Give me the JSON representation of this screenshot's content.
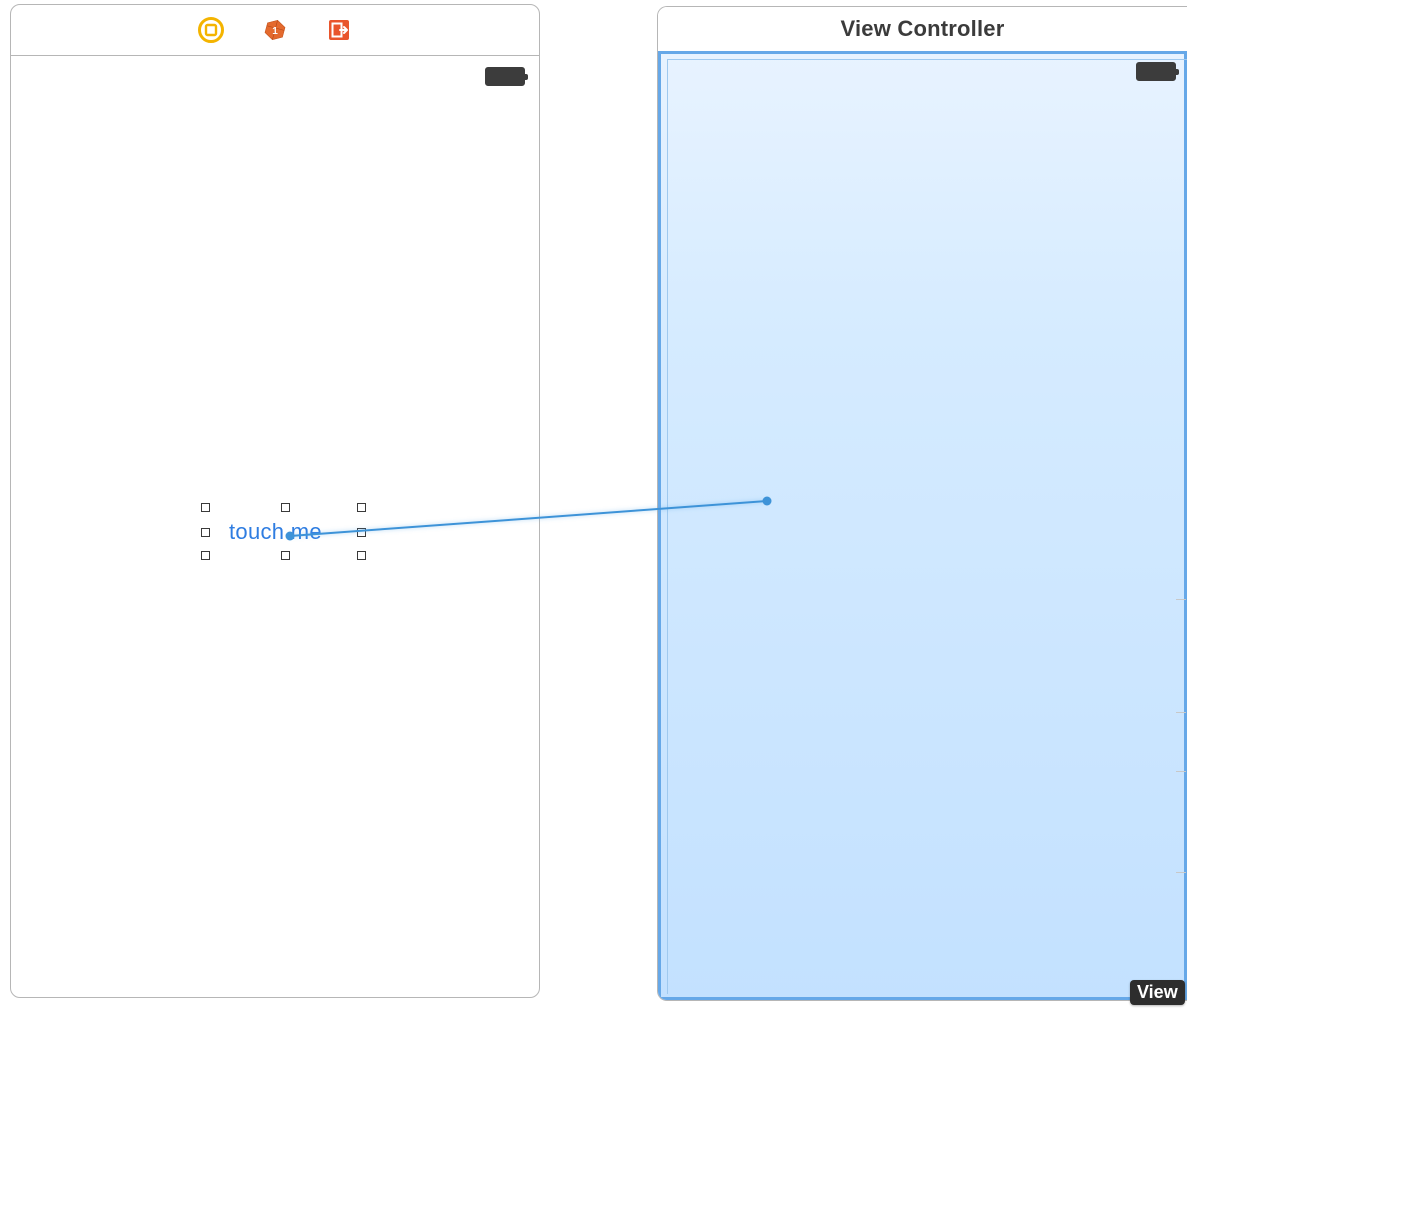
{
  "left_scene": {
    "button_label": "touch me"
  },
  "right_scene": {
    "title": "View Controller"
  },
  "tooltip": {
    "view_label": "View"
  },
  "icons": {
    "controller": "view-controller-icon",
    "responder": "first-responder-icon",
    "exit": "exit-icon",
    "battery": "battery-icon"
  }
}
